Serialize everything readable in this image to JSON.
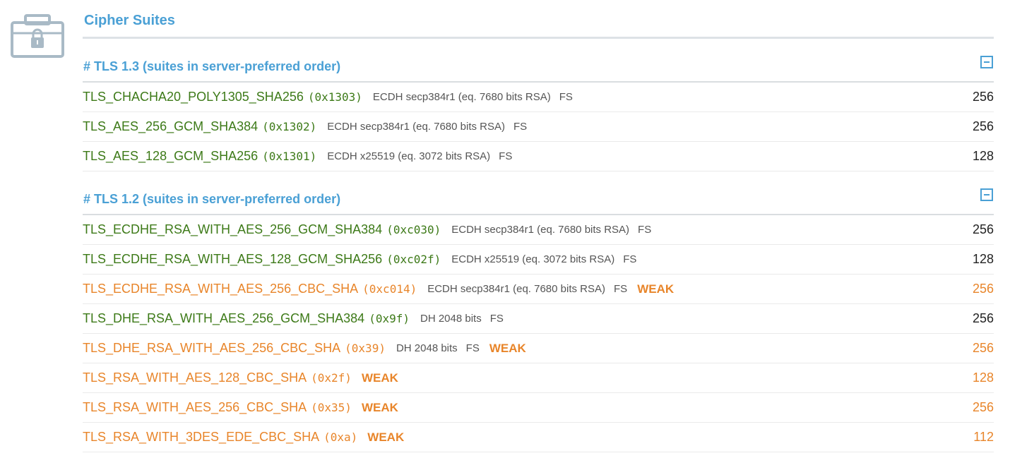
{
  "section_title": "Cipher Suites",
  "icons": {
    "lock": "lock-briefcase-icon",
    "collapse": "minus-square-icon"
  },
  "colors": {
    "accent": "#4aa0d5",
    "strong": "#3d7a18",
    "weak": "#e8852a",
    "muted": "#555555"
  },
  "groups": [
    {
      "title": "# TLS 1.3 (suites in server-preferred order)",
      "rows": [
        {
          "name": "TLS_CHACHA20_POLY1305_SHA256",
          "hex": "(0x1303)",
          "kex": "ECDH secp384r1 (eq. 7680 bits RSA)",
          "fs": "FS",
          "weak": "",
          "bits": "256"
        },
        {
          "name": "TLS_AES_256_GCM_SHA384",
          "hex": "(0x1302)",
          "kex": "ECDH secp384r1 (eq. 7680 bits RSA)",
          "fs": "FS",
          "weak": "",
          "bits": "256"
        },
        {
          "name": "TLS_AES_128_GCM_SHA256",
          "hex": "(0x1301)",
          "kex": "ECDH x25519 (eq. 3072 bits RSA)",
          "fs": "FS",
          "weak": "",
          "bits": "128"
        }
      ]
    },
    {
      "title": "# TLS 1.2 (suites in server-preferred order)",
      "rows": [
        {
          "name": "TLS_ECDHE_RSA_WITH_AES_256_GCM_SHA384",
          "hex": "(0xc030)",
          "kex": "ECDH secp384r1 (eq. 7680 bits RSA)",
          "fs": "FS",
          "weak": "",
          "bits": "256"
        },
        {
          "name": "TLS_ECDHE_RSA_WITH_AES_128_GCM_SHA256",
          "hex": "(0xc02f)",
          "kex": "ECDH x25519 (eq. 3072 bits RSA)",
          "fs": "FS",
          "weak": "",
          "bits": "128"
        },
        {
          "name": "TLS_ECDHE_RSA_WITH_AES_256_CBC_SHA",
          "hex": "(0xc014)",
          "kex": "ECDH secp384r1 (eq. 7680 bits RSA)",
          "fs": "FS",
          "weak": "WEAK",
          "bits": "256"
        },
        {
          "name": "TLS_DHE_RSA_WITH_AES_256_GCM_SHA384",
          "hex": "(0x9f)",
          "kex": "DH 2048 bits",
          "fs": "FS",
          "weak": "",
          "bits": "256"
        },
        {
          "name": "TLS_DHE_RSA_WITH_AES_256_CBC_SHA",
          "hex": "(0x39)",
          "kex": "DH 2048 bits",
          "fs": "FS",
          "weak": "WEAK",
          "bits": "256"
        },
        {
          "name": "TLS_RSA_WITH_AES_128_CBC_SHA",
          "hex": "(0x2f)",
          "kex": "",
          "fs": "",
          "weak": "WEAK",
          "bits": "128"
        },
        {
          "name": "TLS_RSA_WITH_AES_256_CBC_SHA",
          "hex": "(0x35)",
          "kex": "",
          "fs": "",
          "weak": "WEAK",
          "bits": "256"
        },
        {
          "name": "TLS_RSA_WITH_3DES_EDE_CBC_SHA",
          "hex": "(0xa)",
          "kex": "",
          "fs": "",
          "weak": "WEAK",
          "bits": "112"
        }
      ]
    }
  ]
}
